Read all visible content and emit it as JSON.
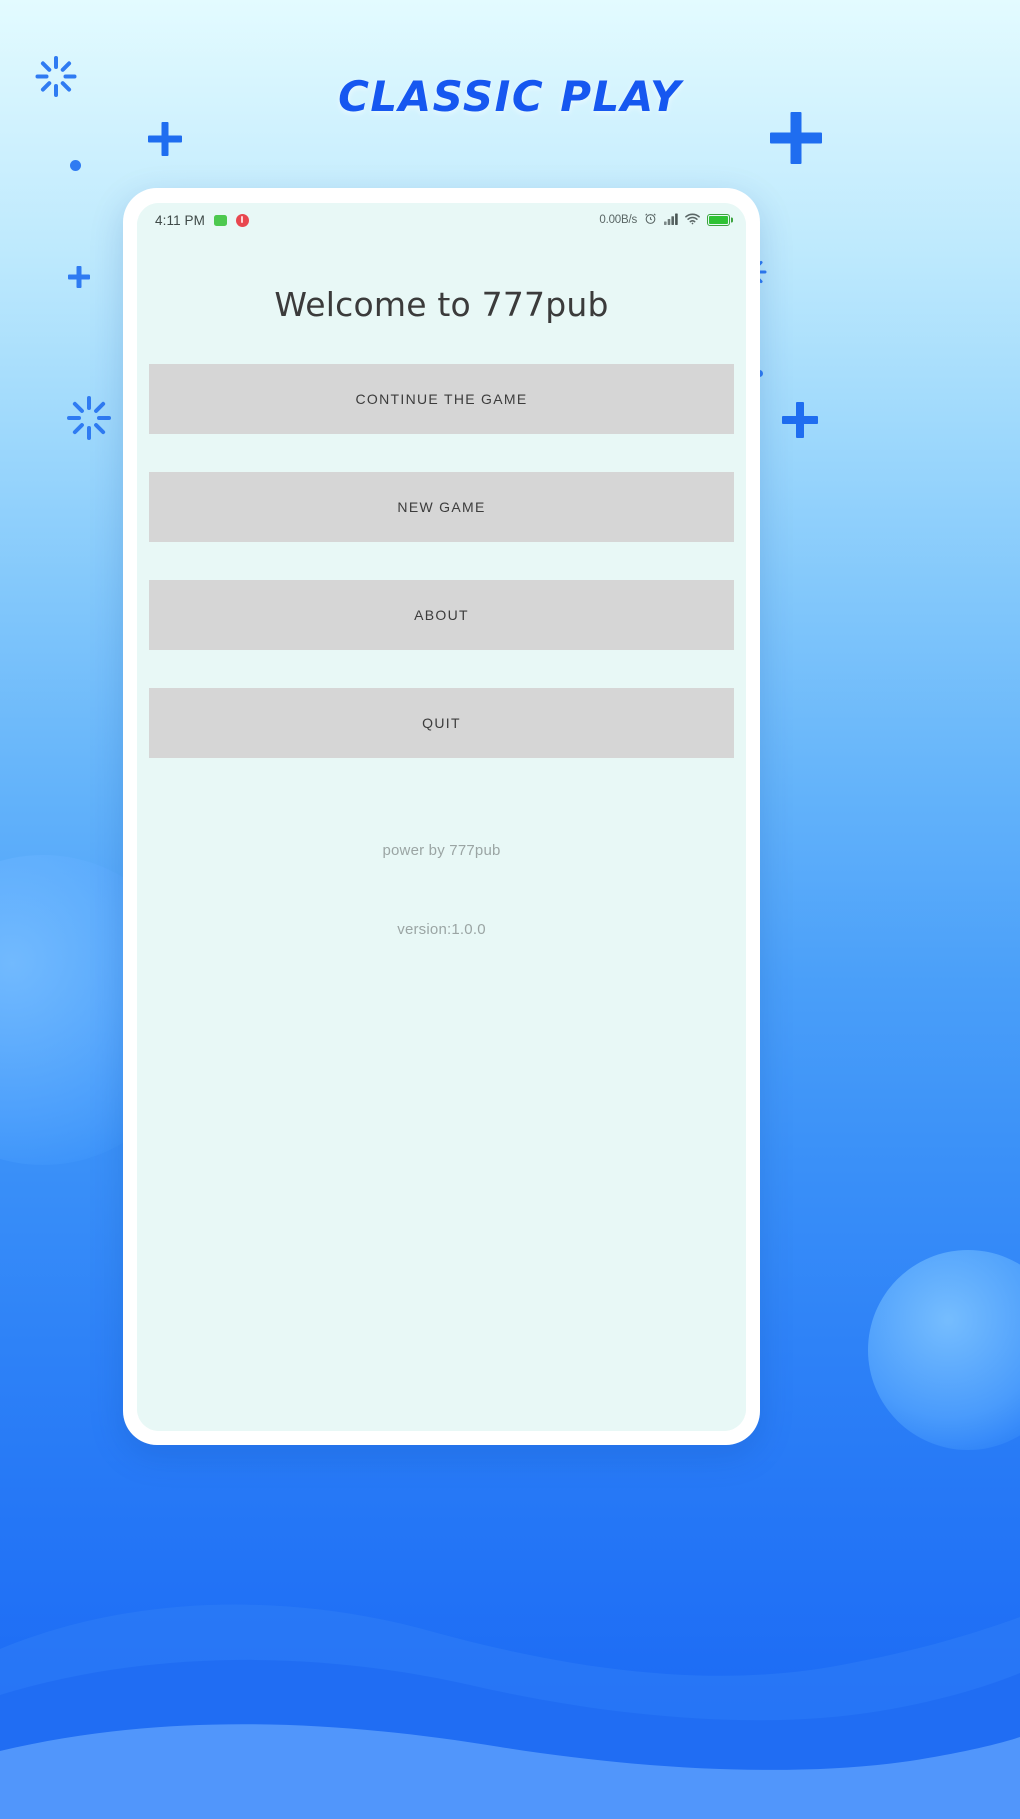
{
  "page": {
    "app_title": "CLASSIC PLAY",
    "background_top_color": "#e3fbff",
    "background_bottom_color": "#1866f4",
    "accent_color": "#1657f0"
  },
  "phone": {
    "statusbar": {
      "time": "4:11 PM",
      "left_icons": [
        "green-square-icon",
        "red-record-icon"
      ],
      "network_speed": "0.00B/s",
      "right_icons": [
        "alarm-clock-icon",
        "signal-bars-icon",
        "wifi-icon",
        "battery-icon"
      ],
      "battery_color": "#2fc234"
    },
    "screen": {
      "welcome_title": "Welcome to 777pub",
      "menu": [
        {
          "id": "continue",
          "label": "CONTINUE THE GAME"
        },
        {
          "id": "new-game",
          "label": "NEW GAME"
        },
        {
          "id": "about",
          "label": "ABOUT"
        },
        {
          "id": "quit",
          "label": "QUIT"
        }
      ],
      "footer": {
        "power_by": "power by 777pub",
        "version": "version:1.0.0"
      },
      "screen_bg_color": "#e8f8f6",
      "button_bg_color": "#d6d6d6"
    }
  },
  "decorations": {
    "plus_marks": 4,
    "sparkles": 3,
    "dots": 1,
    "blobs": 2
  }
}
